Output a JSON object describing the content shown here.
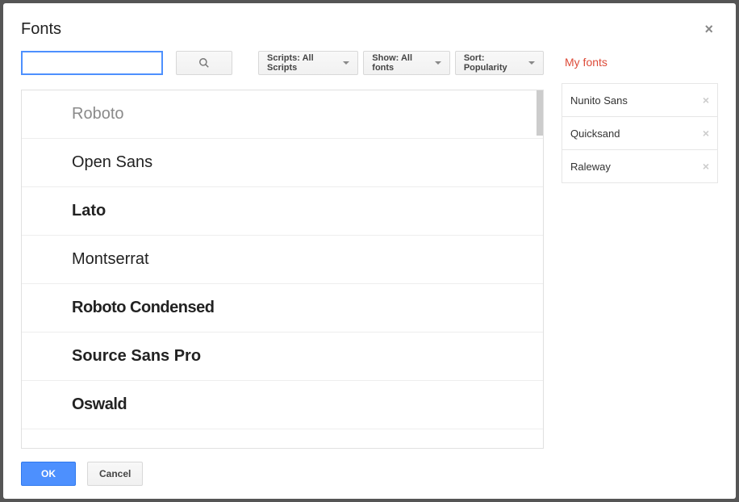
{
  "dialog": {
    "title": "Fonts"
  },
  "toolbar": {
    "search_value": "",
    "search_placeholder": "",
    "filters": {
      "scripts": "Scripts: All Scripts",
      "show": "Show: All fonts",
      "sort": "Sort: Popularity"
    }
  },
  "fonts": [
    {
      "name": "Roboto"
    },
    {
      "name": "Open Sans"
    },
    {
      "name": "Lato"
    },
    {
      "name": "Montserrat"
    },
    {
      "name": "Roboto Condensed"
    },
    {
      "name": "Source Sans Pro"
    },
    {
      "name": "Oswald"
    }
  ],
  "sidebar": {
    "title": "My fonts",
    "items": [
      {
        "name": "Nunito Sans"
      },
      {
        "name": "Quicksand"
      },
      {
        "name": "Raleway"
      }
    ]
  },
  "footer": {
    "ok_label": "OK",
    "cancel_label": "Cancel"
  }
}
